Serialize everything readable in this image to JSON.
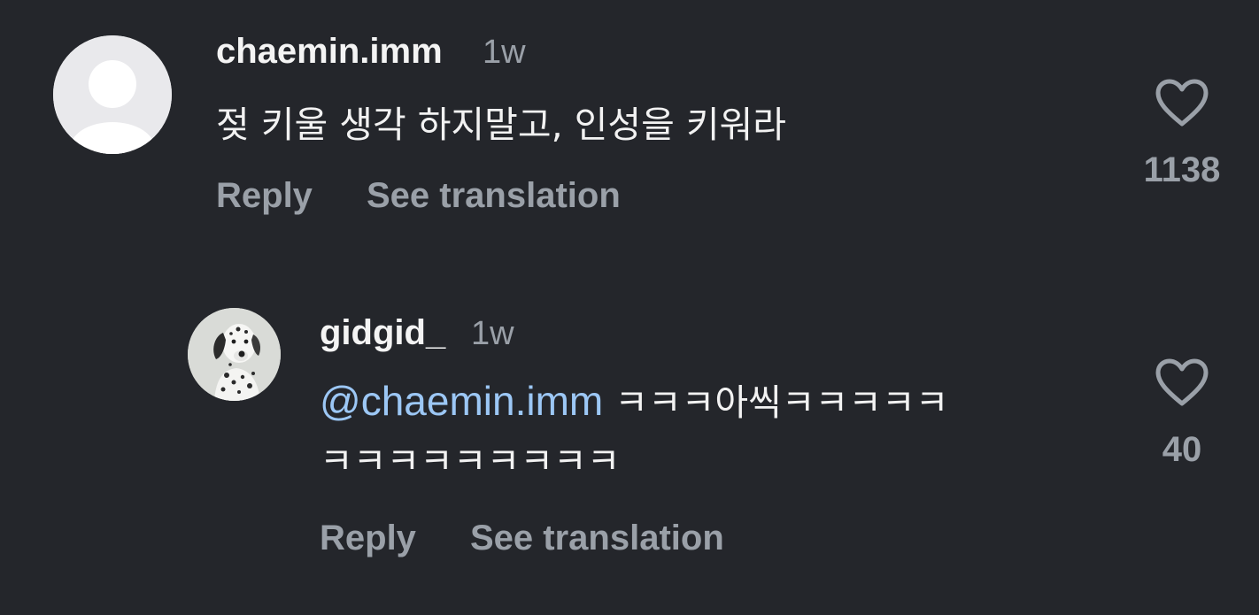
{
  "comments": [
    {
      "username": "chaemin.imm",
      "time": "1w",
      "text": "젖 키울 생각 하지말고, 인성을 키워라",
      "reply_label": "Reply",
      "translate_label": "See translation",
      "like_count": "1138",
      "avatar_icon": "default-avatar-icon"
    },
    {
      "username": "gidgid_",
      "time": "1w",
      "mention": "@chaemin.imm",
      "text_line1": " ㅋㅋㅋ아씩ㅋㅋㅋㅋㅋ",
      "text_line2": "ㅋㅋㅋㅋㅋㅋㅋㅋㅋ",
      "reply_label": "Reply",
      "translate_label": "See translation",
      "like_count": "40",
      "avatar_icon": "dalmatian-avatar-icon"
    }
  ],
  "colors": {
    "background": "#24262b",
    "primary_text": "#f2f2f2",
    "secondary_text": "#9aa0a8",
    "mention": "#9cc7f5"
  }
}
